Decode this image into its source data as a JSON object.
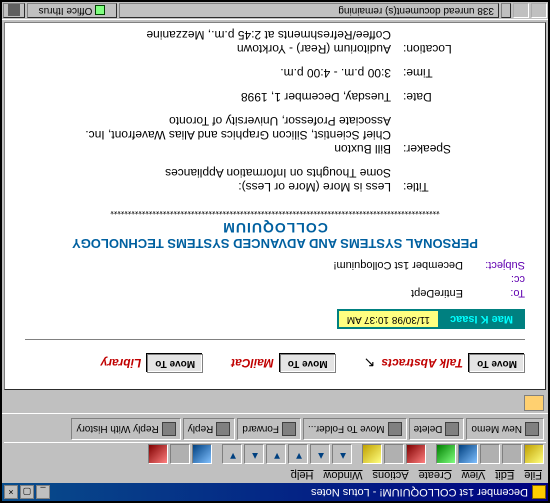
{
  "titlebar": {
    "text": "December 1st COLLOQUIUM! - Lotus Notes"
  },
  "menubar": {
    "file": "File",
    "edit": "Edit",
    "view": "View",
    "create": "Create",
    "actions": "Actions",
    "window": "Window",
    "help": "Help"
  },
  "actions": {
    "new_memo": "New Memo",
    "delete": "Delete",
    "move_to_folder": "Move To Folder...",
    "forward": "Forward",
    "reply": "Reply",
    "reply_with_history": "Reply With History"
  },
  "move_to": {
    "button": "Move To",
    "talk_abstracts": "Talk Abstracts",
    "mailcat": "MailCat",
    "library": "Library"
  },
  "sender": {
    "name": "Mae K Isaac",
    "timestamp": "11/30/98 10:37 AM"
  },
  "headers": {
    "to_label": "To:",
    "to_value": "EntireDept",
    "cc_label": "cc:",
    "cc_value": "",
    "subject_label": "Subject:",
    "subject_value": "December 1st Colloquium!"
  },
  "announce": {
    "line1": "PERSONAL SYSTEMS AND ADVANCED SYSTEMS TECHNOLOGY",
    "line2": "COLLOQUIUM",
    "stars": "**********************************************************************************************"
  },
  "body": {
    "title_label": "Title:",
    "title_value_l1": "Less is More (More or Less):",
    "title_value_l2": "Some Thoughts on Information Appliances",
    "speaker_label": "Speaker:",
    "speaker_l1": "Bill Buxton",
    "speaker_l2": "Chief Scientist, Silicon Graphics and Alias Wavefront, Inc.",
    "speaker_l3": "Associate Professor, University of Toronto",
    "date_label": "Date:",
    "date_value": "Tuesday, December 1, 1998",
    "time_label": "Time:",
    "time_value": "3:00 p.m. - 4:00 p.m.",
    "location_label": "Location:",
    "location_l1": "Auditorium (Rear) - Yorktown",
    "location_l2": "Coffee/Refreshments at 2:45 p.m., Mezzanine"
  },
  "statusbar": {
    "unread": "338 unread document(s) remaining",
    "server": "Office Ithrus"
  }
}
